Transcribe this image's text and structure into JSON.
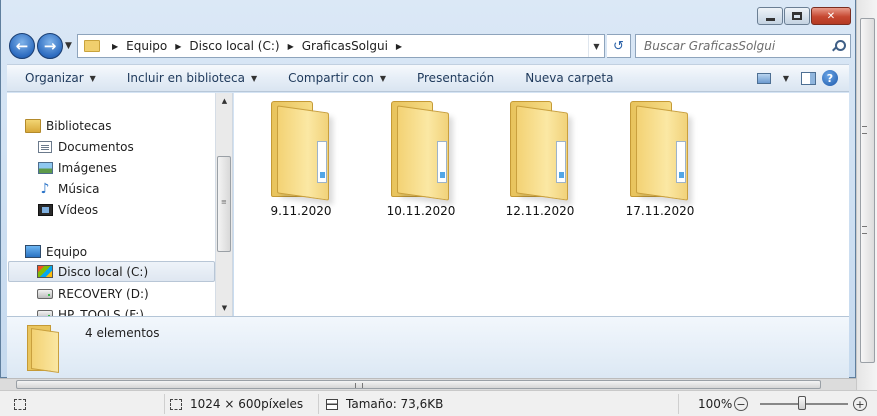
{
  "window": {
    "caption_buttons": {
      "minimize": "minimize-icon",
      "maximize": "maximize-icon",
      "close": "✕"
    }
  },
  "navigation": {
    "back_icon": "arrow-left-icon",
    "forward_icon": "arrow-right-icon",
    "breadcrumb": [
      "Equipo",
      "Disco local (C:)",
      "GraficasSolgui"
    ],
    "search_placeholder": "Buscar GraficasSolgui"
  },
  "commandbar": {
    "items": [
      {
        "label": "Organizar",
        "has_dropdown": true
      },
      {
        "label": "Incluir en biblioteca",
        "has_dropdown": true
      },
      {
        "label": "Compartir con",
        "has_dropdown": true
      },
      {
        "label": "Presentación",
        "has_dropdown": false
      },
      {
        "label": "Nueva carpeta",
        "has_dropdown": false
      }
    ],
    "help_label": "?"
  },
  "nav_pane": {
    "items": [
      {
        "label": "Bibliotecas",
        "icon": "library-icon",
        "indent": 0
      },
      {
        "label": "Documentos",
        "icon": "documents-icon",
        "indent": 1
      },
      {
        "label": "Imágenes",
        "icon": "pictures-icon",
        "indent": 1
      },
      {
        "label": "Música",
        "icon": "music-icon",
        "indent": 1
      },
      {
        "label": "Vídeos",
        "icon": "videos-icon",
        "indent": 1
      },
      {
        "label": "Equipo",
        "icon": "computer-icon",
        "indent": 0
      },
      {
        "label": "Disco local (C:)",
        "icon": "system-drive-icon",
        "indent": 1,
        "selected": true
      },
      {
        "label": "RECOVERY (D:)",
        "icon": "drive-icon",
        "indent": 1
      },
      {
        "label": "HP_TOOLS (F:)",
        "icon": "drive-icon",
        "indent": 1
      }
    ]
  },
  "files": [
    {
      "name": "9.11.2020",
      "type": "folder"
    },
    {
      "name": "10.11.2020",
      "type": "folder"
    },
    {
      "name": "12.11.2020",
      "type": "folder"
    },
    {
      "name": "17.11.2020",
      "type": "folder"
    }
  ],
  "details": {
    "count_text": "4 elementos"
  },
  "statusbar": {
    "dimensions": "1024 × 600píxeles",
    "size": "Tamaño: 73,6KB",
    "zoom": "100%",
    "zoom_out": "−",
    "zoom_in": "+"
  }
}
